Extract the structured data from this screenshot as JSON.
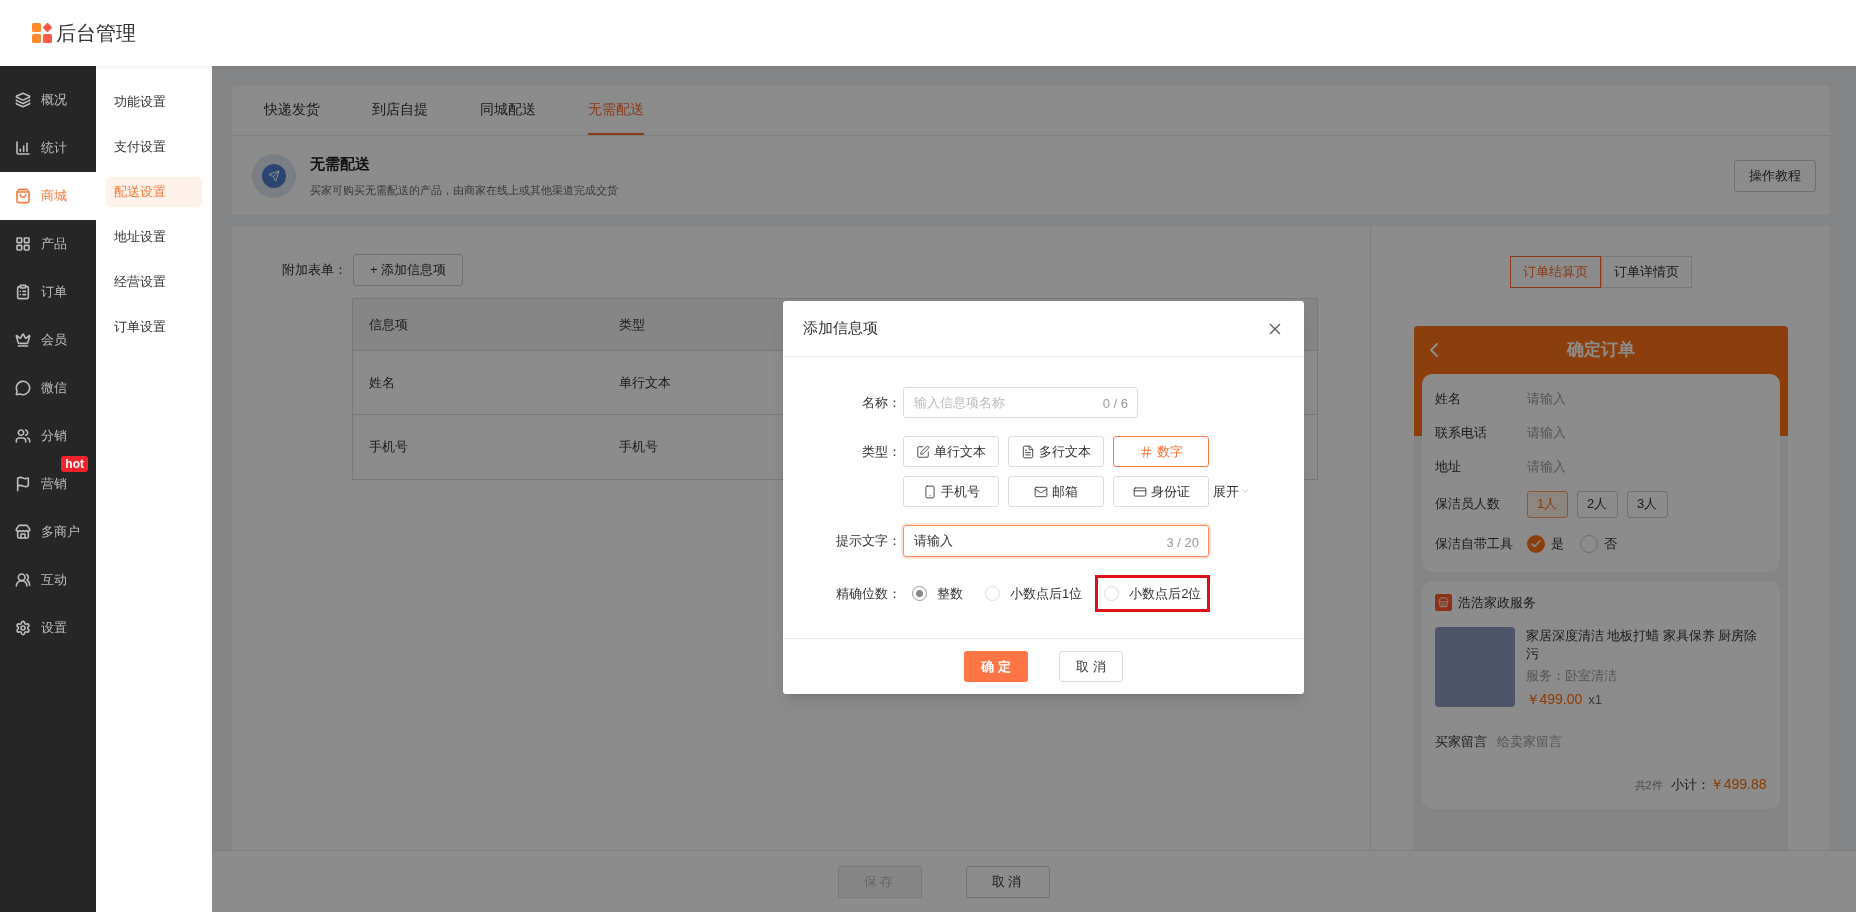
{
  "header": {
    "title": "后台管理"
  },
  "nav": {
    "items": [
      {
        "label": "概况",
        "selected": false
      },
      {
        "label": "统计",
        "selected": false
      },
      {
        "label": "商城",
        "selected": true
      },
      {
        "label": "产品",
        "selected": false
      },
      {
        "label": "订单",
        "selected": false
      },
      {
        "label": "会员",
        "selected": false
      },
      {
        "label": "微信",
        "selected": false
      },
      {
        "label": "分销",
        "selected": false
      },
      {
        "label": "营销",
        "selected": false,
        "badge": "hot"
      },
      {
        "label": "多商户",
        "selected": false
      },
      {
        "label": "互动",
        "selected": false
      },
      {
        "label": "设置",
        "selected": false
      }
    ]
  },
  "subnav": {
    "items": [
      {
        "label": "功能设置",
        "selected": false
      },
      {
        "label": "支付设置",
        "selected": false
      },
      {
        "label": "配送设置",
        "selected": true
      },
      {
        "label": "地址设置",
        "selected": false
      },
      {
        "label": "经营设置",
        "selected": false
      },
      {
        "label": "订单设置",
        "selected": false
      }
    ]
  },
  "tabs": [
    {
      "label": "快递发货",
      "selected": false
    },
    {
      "label": "到店自提",
      "selected": false
    },
    {
      "label": "同城配送",
      "selected": false
    },
    {
      "label": "无需配送",
      "selected": true
    }
  ],
  "info": {
    "title": "无需配送",
    "description": "买家可购买无需配送的产品，由商家在线上或其他渠道完成交货",
    "tutorial_button": "操作教程"
  },
  "form": {
    "label": "附加表单：",
    "add_button": "+ 添加信息项",
    "table": {
      "columns": [
        "信息项",
        "类型"
      ],
      "rows": [
        [
          "姓名",
          "单行文本"
        ],
        [
          "手机号",
          "手机号"
        ]
      ]
    }
  },
  "preview": {
    "tabs": [
      {
        "label": "订单结算页",
        "selected": true
      },
      {
        "label": "订单详情页",
        "selected": false
      }
    ],
    "title": "确定订单",
    "fields": [
      {
        "label": "姓名",
        "placeholder": "请输入"
      },
      {
        "label": "联系电话",
        "placeholder": "请输入"
      },
      {
        "label": "地址",
        "placeholder": "请输入"
      }
    ],
    "staff": {
      "label": "保洁员人数",
      "options": [
        {
          "label": "1人",
          "selected": true
        },
        {
          "label": "2人",
          "selected": false
        },
        {
          "label": "3人",
          "selected": false
        }
      ]
    },
    "tools": {
      "label": "保洁自带工具",
      "options": [
        {
          "label": "是",
          "selected": true
        },
        {
          "label": "否",
          "selected": false
        }
      ]
    },
    "shop": "浩浩家政服务",
    "product": {
      "title": "家居深度清洁 地板打蜡 家具保养 厨房除污",
      "service": "服务：卧室清洁",
      "price": "￥499.00",
      "quantity": "x1"
    },
    "message": {
      "label": "买家留言",
      "placeholder": "给卖家留言"
    },
    "count": "共2件",
    "subtotal_label": "小计：",
    "subtotal": "￥499.88"
  },
  "footer": {
    "buttons": [
      {
        "label": "保存",
        "disabled": true
      },
      {
        "label": "取消",
        "disabled": false
      }
    ]
  },
  "dialog": {
    "title": "添加信息项",
    "name": {
      "label": "名称：",
      "placeholder": "输入信息项名称",
      "counter": "0 / 6"
    },
    "type": {
      "label": "类型：",
      "options": [
        {
          "label": "单行文本",
          "selected": false
        },
        {
          "label": "多行文本",
          "selected": false
        },
        {
          "label": "数字",
          "selected": true
        },
        {
          "label": "手机号",
          "selected": false
        },
        {
          "label": "邮箱",
          "selected": false
        },
        {
          "label": "身份证",
          "selected": false
        }
      ],
      "expand": "展开"
    },
    "hint": {
      "label": "提示文字：",
      "value": "请输入",
      "counter": "3 / 20"
    },
    "precision": {
      "label": "精确位数：",
      "options": [
        {
          "label": "整数",
          "selected": true,
          "highlighted": false
        },
        {
          "label": "小数点后1位",
          "selected": false,
          "highlighted": false
        },
        {
          "label": "小数点后2位",
          "selected": false,
          "highlighted": true
        }
      ]
    },
    "confirm": "确 定",
    "cancel": "取 消"
  }
}
